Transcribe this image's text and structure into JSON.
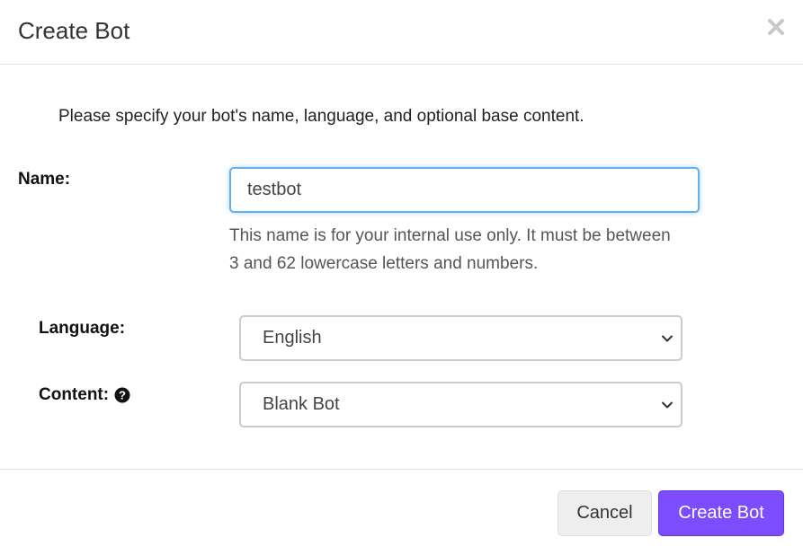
{
  "dialog": {
    "title": "Create Bot",
    "close_icon": "close-icon"
  },
  "body": {
    "intro": "Please specify your bot's name, language, and optional base content.",
    "name": {
      "label": "Name:",
      "value": "testbot",
      "help": "This name is for your internal use only. It must be between 3 and 62 lowercase letters and numbers."
    },
    "language": {
      "label": "Language:",
      "selected": "English"
    },
    "content": {
      "label": "Content:",
      "help_icon": "question-circle-icon",
      "selected": "Blank Bot"
    }
  },
  "footer": {
    "cancel_label": "Cancel",
    "create_label": "Create Bot"
  },
  "colors": {
    "accent": "#7c4dff",
    "focus_border": "#66afe9"
  }
}
